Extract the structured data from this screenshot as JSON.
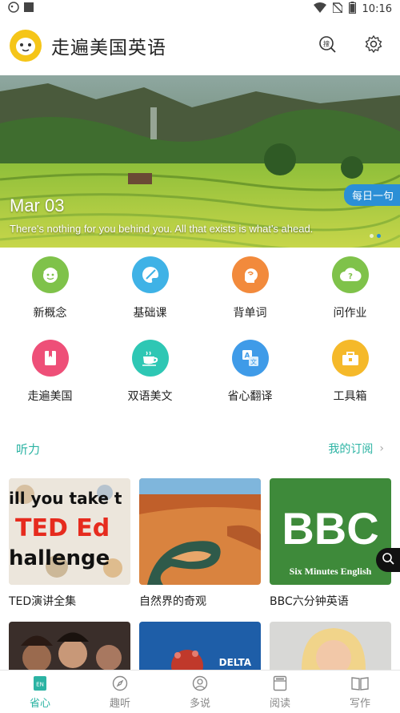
{
  "status_bar": {
    "time": "10:16"
  },
  "header": {
    "title": "走遍美国英语",
    "search_icon_text": "搜"
  },
  "banner": {
    "date": "Mar 03",
    "quote": "There's nothing for you behind you. All that exists is what's ahead.",
    "badge": "每日一句"
  },
  "grid": [
    {
      "label": "新概念",
      "icon": "face-icon",
      "color": "#7fc24a"
    },
    {
      "label": "基础课",
      "icon": "palette-icon",
      "color": "#3fb2e6"
    },
    {
      "label": "背单词",
      "icon": "brain-icon",
      "color": "#f28a3c"
    },
    {
      "label": "问作业",
      "icon": "question-cloud-icon",
      "color": "#7fc24a"
    },
    {
      "label": "走遍美国",
      "icon": "book-icon",
      "color": "#ee4f78"
    },
    {
      "label": "双语美文",
      "icon": "coffee-icon",
      "color": "#2ec7b4"
    },
    {
      "label": "省心翻译",
      "icon": "translate-icon",
      "color": "#3f9be8"
    },
    {
      "label": "工具箱",
      "icon": "toolbox-icon",
      "color": "#f5b92a"
    }
  ],
  "section": {
    "title": "听力",
    "link": "我的订阅"
  },
  "cards": [
    {
      "title": "TED演讲全集",
      "thumb_lines": [
        "ill you take t",
        "TED Ed",
        "hallenge"
      ]
    },
    {
      "title": "自然界的奇观"
    },
    {
      "title": "BBC六分钟英语",
      "thumb_big": "BBC",
      "thumb_small": "Six Minutes English"
    },
    {
      "title": ""
    },
    {
      "title": "",
      "thumb_text": "DELTA"
    },
    {
      "title": ""
    }
  ],
  "bottom_nav": [
    {
      "label": "省心",
      "icon": "en-book-icon",
      "active": true,
      "badge": "EN"
    },
    {
      "label": "趣听",
      "icon": "compass-icon",
      "active": false
    },
    {
      "label": "多说",
      "icon": "person-icon",
      "active": false
    },
    {
      "label": "阅读",
      "icon": "reader-icon",
      "active": false
    },
    {
      "label": "写作",
      "icon": "open-book-icon",
      "active": false
    }
  ],
  "colors": {
    "accent": "#2bb3a3",
    "badge_blue": "#2b8fd6"
  }
}
